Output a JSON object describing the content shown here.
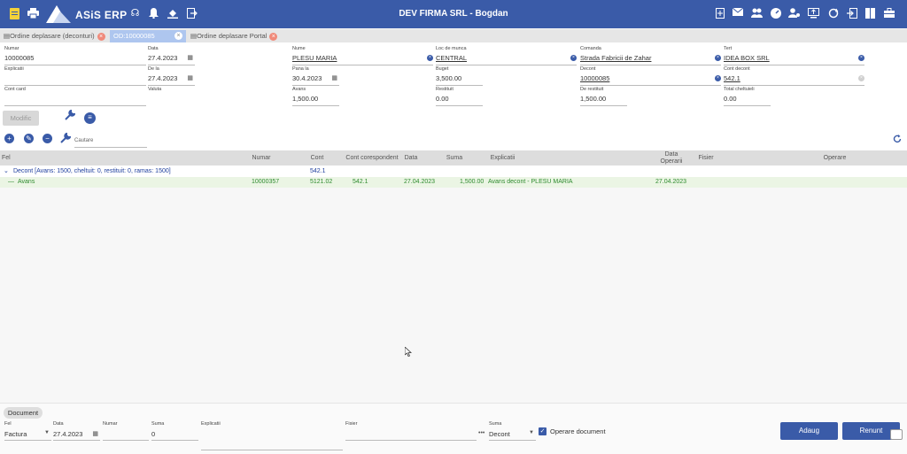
{
  "header": {
    "brand": "ASiS ERP",
    "title": "DEV FIRMA SRL - Bogdan"
  },
  "tabs": [
    {
      "label": "Ordine deplasare (deconturi)",
      "close": "×"
    },
    {
      "label": "OD:10000085",
      "close": "×"
    },
    {
      "label": "Ordine deplasare Portal",
      "close": "×"
    }
  ],
  "form": {
    "numar": {
      "label": "Numar",
      "value": "10000085"
    },
    "data": {
      "label": "Data",
      "value": "27.4.2023"
    },
    "nume": {
      "label": "Nume",
      "value": "PLESU MARIA"
    },
    "loc_munca": {
      "label": "Loc de munca",
      "value": "CENTRAL"
    },
    "comanda": {
      "label": "Comanda",
      "value": "Strada Fabricii de Zahar"
    },
    "tert": {
      "label": "Tert",
      "value": "IDEA BOX SRL"
    },
    "explicatii": {
      "label": "Explicatii",
      "value": ""
    },
    "de_la": {
      "label": "De la",
      "value": "27.4.2023"
    },
    "pana_la": {
      "label": "Pana la",
      "value": "30.4.2023"
    },
    "buget": {
      "label": "Buget",
      "value": "3,500.00"
    },
    "decont": {
      "label": "Decont",
      "value": "10000085"
    },
    "cont_decont": {
      "label": "Cont decont",
      "value": "542.1"
    },
    "cont_card": {
      "label": "Cont card",
      "value": ""
    },
    "valuta": {
      "label": "Valuta",
      "value": ""
    },
    "avans": {
      "label": "Avans",
      "value": "1,500.00"
    },
    "restituit": {
      "label": "Restituit",
      "value": "0.00"
    },
    "de_restituit": {
      "label": "De restituit",
      "value": "1,500.00"
    },
    "total_cheltuieli": {
      "label": "Total cheltuieli",
      "value": "0.00"
    }
  },
  "actions": {
    "modific": "Modific",
    "search_placeholder": "Cautare"
  },
  "grid": {
    "columns": {
      "fel": "Fel",
      "numar": "Numar",
      "cont": "Cont",
      "cont_corespondent": "Cont corespondent",
      "data": "Data",
      "suma": "Suma",
      "explicatii": "Explicatii",
      "data_operarii": "Data Operarii",
      "fisier": "Fisier",
      "operare": "Operare"
    },
    "group": {
      "label": "Decont [Avans: 1500, cheltuit: 0, restituit: 0, ramas: 1500]",
      "cont": "542.1"
    },
    "rows": [
      {
        "fel": "Avans",
        "numar": "10000357",
        "cont": "5121.02",
        "cont_corespondent": "542.1",
        "data": "27.04.2023",
        "suma": "1,500.00",
        "explicatii": "Avans decont - PLESU MARIA",
        "data_operarii": "27.04.2023"
      }
    ]
  },
  "document": {
    "tab": "Document",
    "fel": {
      "label": "Fel",
      "value": "Factura"
    },
    "data": {
      "label": "Data",
      "value": "27.4.2023"
    },
    "numar": {
      "label": "Numar",
      "value": ""
    },
    "suma": {
      "label": "Suma",
      "value": "0"
    },
    "explicatii": {
      "label": "Explicatii",
      "value": ""
    },
    "fisier": {
      "label": "Fisier",
      "value": ""
    },
    "suma2": {
      "label": "Suma",
      "value": "Decont"
    },
    "operare_document": "Operare document",
    "adaug": "Adaug",
    "renunt": "Renunt"
  },
  "colors": {
    "primary": "#3a5ba8",
    "green_row": "#ebf5e4",
    "green_text": "#2e8b2e"
  }
}
